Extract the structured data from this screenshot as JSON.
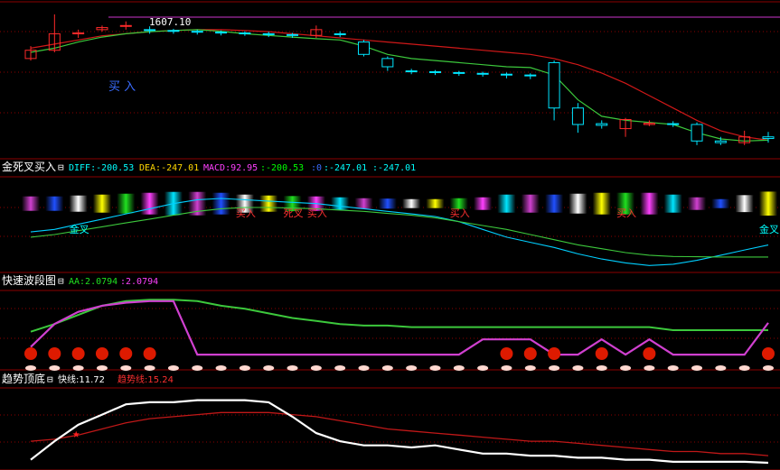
{
  "colors": {
    "background": "#000000",
    "panel_border": "#8b0000",
    "grid": "#8b0000",
    "candle_up": "#ff2a2a",
    "candle_down": "#00e5ff",
    "ma_red": "#d01818",
    "ma_green": "#3cc83c",
    "label_white": "#ffffff",
    "label_cyan": "#00ffff",
    "label_magenta": "#ff40ff",
    "label_green": "#20e020",
    "label_red": "#ff3030",
    "buy_blue": "#3a6cff",
    "fast_line": "#ffffff",
    "trend_line": "#c01818",
    "dot_red": "#dd1a00",
    "dot_pink": "#ffd8d0",
    "ma_magenta": "#d040d0",
    "price_line": "#cc33cc"
  },
  "main_panel": {
    "price_label": "1607.10",
    "buy_label": "买 入"
  },
  "macd_panel": {
    "title": "金死叉买入",
    "toggle": "⊟",
    "diff_label": "DIFF:-200.53",
    "dea_label": "DEA:-247.01",
    "macd_label": "MACD:92.95",
    "extra1": ":-200.53",
    "extra2": ":0",
    "extra3": ":-247.01",
    "extra4": ":-247.01",
    "annotations": [
      "金叉",
      "买入",
      "死叉",
      "买入",
      "买入",
      "买入",
      "金叉"
    ]
  },
  "wave_panel": {
    "title": "快速波段图",
    "toggle": "⊟",
    "aa_label": "AA:2.0794",
    "aa_extra": ":2.0794"
  },
  "trend_panel": {
    "title": "趋势顶底",
    "toggle": "⊟",
    "fast_label": "快线:11.72",
    "trend_label": "趋势线:15.24"
  },
  "chart_data": [
    {
      "type": "candlestick",
      "title": "",
      "price_label": "1607.10",
      "candles": [
        {
          "o": 1500,
          "c": 1520,
          "h": 1530,
          "l": 1495
        },
        {
          "o": 1520,
          "c": 1560,
          "h": 1607,
          "l": 1515
        },
        {
          "o": 1560,
          "c": 1562,
          "h": 1570,
          "l": 1550
        },
        {
          "o": 1570,
          "c": 1575,
          "h": 1580,
          "l": 1565
        },
        {
          "o": 1578,
          "c": 1580,
          "h": 1590,
          "l": 1570
        },
        {
          "o": 1570,
          "c": 1568,
          "h": 1578,
          "l": 1560
        },
        {
          "o": 1568,
          "c": 1566,
          "h": 1572,
          "l": 1560
        },
        {
          "o": 1566,
          "c": 1564,
          "h": 1570,
          "l": 1558
        },
        {
          "o": 1564,
          "c": 1562,
          "h": 1568,
          "l": 1556
        },
        {
          "o": 1562,
          "c": 1560,
          "h": 1566,
          "l": 1555
        },
        {
          "o": 1560,
          "c": 1558,
          "h": 1565,
          "l": 1552
        },
        {
          "o": 1558,
          "c": 1556,
          "h": 1562,
          "l": 1550
        },
        {
          "o": 1556,
          "c": 1570,
          "h": 1580,
          "l": 1550
        },
        {
          "o": 1560,
          "c": 1558,
          "h": 1566,
          "l": 1552
        },
        {
          "o": 1540,
          "c": 1510,
          "h": 1545,
          "l": 1505
        },
        {
          "o": 1500,
          "c": 1480,
          "h": 1505,
          "l": 1470
        },
        {
          "o": 1470,
          "c": 1468,
          "h": 1475,
          "l": 1462
        },
        {
          "o": 1468,
          "c": 1466,
          "h": 1472,
          "l": 1460
        },
        {
          "o": 1466,
          "c": 1464,
          "h": 1470,
          "l": 1458
        },
        {
          "o": 1464,
          "c": 1462,
          "h": 1468,
          "l": 1456
        },
        {
          "o": 1462,
          "c": 1460,
          "h": 1466,
          "l": 1452
        },
        {
          "o": 1460,
          "c": 1458,
          "h": 1464,
          "l": 1450
        },
        {
          "o": 1490,
          "c": 1380,
          "h": 1495,
          "l": 1350
        },
        {
          "o": 1380,
          "c": 1340,
          "h": 1392,
          "l": 1320
        },
        {
          "o": 1342,
          "c": 1338,
          "h": 1350,
          "l": 1330
        },
        {
          "o": 1330,
          "c": 1352,
          "h": 1356,
          "l": 1310
        },
        {
          "o": 1340,
          "c": 1343,
          "h": 1350,
          "l": 1336
        },
        {
          "o": 1342,
          "c": 1340,
          "h": 1348,
          "l": 1334
        },
        {
          "o": 1340,
          "c": 1300,
          "h": 1345,
          "l": 1290
        },
        {
          "o": 1300,
          "c": 1296,
          "h": 1310,
          "l": 1290
        },
        {
          "o": 1296,
          "c": 1310,
          "h": 1325,
          "l": 1290
        },
        {
          "o": 1310,
          "c": 1306,
          "h": 1322,
          "l": 1296
        }
      ],
      "ma_red": [
        1525,
        1535,
        1545,
        1555,
        1560,
        1565,
        1568,
        1570,
        1570,
        1568,
        1565,
        1560,
        1555,
        1550,
        1545,
        1540,
        1535,
        1530,
        1525,
        1520,
        1515,
        1510,
        1500,
        1485,
        1465,
        1440,
        1410,
        1380,
        1350,
        1325,
        1310,
        1302
      ],
      "ma_green": [
        1515,
        1525,
        1540,
        1552,
        1560,
        1565,
        1568,
        1570,
        1566,
        1560,
        1556,
        1552,
        1548,
        1545,
        1530,
        1510,
        1500,
        1495,
        1490,
        1485,
        1480,
        1478,
        1460,
        1400,
        1360,
        1350,
        1345,
        1340,
        1320,
        1305,
        1300,
        1302
      ],
      "ylim": [
        1270,
        1620
      ]
    },
    {
      "type": "bar",
      "title": "",
      "series": [
        {
          "name": "DIFF",
          "values": [
            -150,
            -140,
            -120,
            -100,
            -80,
            -60,
            -40,
            -25,
            -20,
            -25,
            -30,
            -35,
            -40,
            -50,
            -60,
            -70,
            -80,
            -90,
            -110,
            -140,
            -170,
            -190,
            -210,
            -235,
            -255,
            -270,
            -280,
            -275,
            -260,
            -240,
            -220,
            -200.53
          ]
        },
        {
          "name": "DEA",
          "values": [
            -170,
            -160,
            -145,
            -130,
            -115,
            -100,
            -85,
            -70,
            -60,
            -55,
            -55,
            -57,
            -60,
            -65,
            -70,
            -78,
            -85,
            -95,
            -110,
            -125,
            -140,
            -160,
            -180,
            -200,
            -215,
            -230,
            -240,
            -245,
            -246,
            -247,
            -247.1,
            -247.01
          ]
        },
        {
          "name": "MACD",
          "values": [
            -40,
            -40,
            -50,
            -60,
            -70,
            -80,
            -90,
            -90,
            -80,
            -60,
            -50,
            -44,
            -40,
            -30,
            -20,
            -16,
            -10,
            -10,
            -20,
            -30,
            -60,
            -60,
            -60,
            -70,
            -80,
            -80,
            -80,
            -60,
            -30,
            10,
            54,
            92.95
          ]
        }
      ],
      "ylim": [
        -300,
        50
      ]
    },
    {
      "type": "line",
      "title": "",
      "series": [
        {
          "name": "AA",
          "values": [
            0.5,
            2.0,
            2.8,
            3.2,
            3.4,
            3.5,
            3.5,
            0,
            0,
            0,
            0,
            0,
            0,
            0,
            0,
            0,
            0,
            0,
            0,
            1.0,
            1.0,
            1.0,
            0,
            0,
            1.0,
            0,
            1.0,
            0,
            0,
            0,
            0,
            2.0794
          ]
        }
      ],
      "ma_green": [
        1.5,
        2.0,
        2.6,
        3.2,
        3.5,
        3.6,
        3.6,
        3.5,
        3.2,
        3.0,
        2.7,
        2.4,
        2.2,
        2.0,
        1.9,
        1.9,
        1.8,
        1.8,
        1.8,
        1.8,
        1.8,
        1.8,
        1.8,
        1.8,
        1.8,
        1.8,
        1.8,
        1.6,
        1.6,
        1.6,
        1.6,
        1.6
      ],
      "dots_red": [
        0,
        1,
        2,
        3,
        4,
        5,
        20,
        21,
        22,
        24,
        26,
        31
      ],
      "ylim": [
        -1,
        4.2
      ]
    },
    {
      "type": "line",
      "title": "",
      "series": [
        {
          "name": "快线",
          "values": [
            5,
            14,
            22,
            27,
            32,
            33,
            33,
            34,
            34,
            34,
            33,
            26,
            18,
            14,
            12,
            12,
            11,
            12,
            10,
            8,
            8,
            7,
            7,
            6,
            6,
            5,
            5,
            4,
            4,
            4,
            4,
            3.5
          ]
        },
        {
          "name": "趋势线",
          "values": [
            14,
            15,
            17,
            20,
            23,
            25,
            26,
            27,
            28,
            28,
            28,
            27,
            26,
            24,
            22,
            20,
            19,
            18,
            17,
            16,
            15,
            14,
            14,
            13,
            12,
            11,
            10,
            9,
            9,
            8,
            8,
            7
          ]
        }
      ],
      "ylim": [
        0,
        40
      ]
    }
  ]
}
